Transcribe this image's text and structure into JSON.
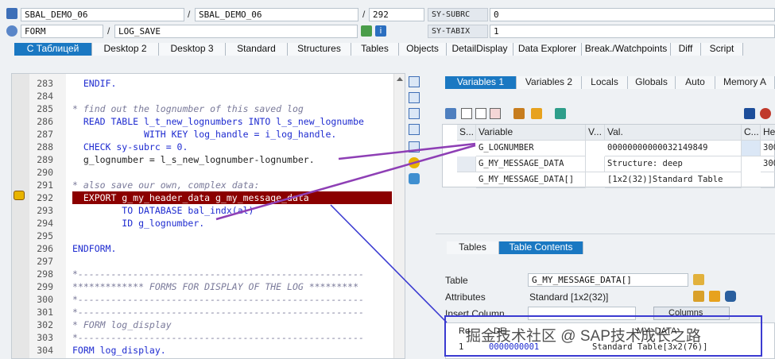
{
  "header": {
    "program1": "SBAL_DEMO_06",
    "program2": "SBAL_DEMO_06",
    "line": "292",
    "subrc_label": "SY-SUBRC",
    "subrc_value": "0",
    "event_type": "FORM",
    "event_name": "LOG_SAVE",
    "tabix_label": "SY-TABIX",
    "tabix_value": "1",
    "sep": "/"
  },
  "desktop_tabs": [
    "С Таблицей",
    "Desktop 2",
    "Desktop 3",
    "Standard",
    "Structures",
    "Tables",
    "Objects",
    "DetailDisplay",
    "Data Explorer",
    "Break./Watchpoints",
    "Diff",
    "Script"
  ],
  "code": {
    "lines": [
      {
        "n": "283",
        "t": "  ENDIF."
      },
      {
        "n": "284",
        "t": ""
      },
      {
        "n": "285",
        "t": "* find out the lognumber of this saved log"
      },
      {
        "n": "286",
        "t": "  READ TABLE l_t_new_lognumbers INTO l_s_new_lognumbe"
      },
      {
        "n": "287",
        "t": "             WITH KEY log_handle = i_log_handle."
      },
      {
        "n": "288",
        "t": "  CHECK sy-subrc = 0."
      },
      {
        "n": "289",
        "t": "  g_lognumber = l_s_new_lognumber-lognumber."
      },
      {
        "n": "290",
        "t": ""
      },
      {
        "n": "291",
        "t": "* also save our own, complex data:"
      },
      {
        "n": "292",
        "t": "  EXPORT g_my_header_data g_my_message_data"
      },
      {
        "n": "293",
        "t": "         TO DATABASE bal_indx(al)"
      },
      {
        "n": "294",
        "t": "         ID g_lognumber."
      },
      {
        "n": "295",
        "t": ""
      },
      {
        "n": "296",
        "t": "ENDFORM."
      },
      {
        "n": "297",
        "t": ""
      },
      {
        "n": "298",
        "t": "*----------------------------------------------------"
      },
      {
        "n": "299",
        "t": "************* FORMS FOR DISPLAY OF THE LOG *********"
      },
      {
        "n": "300",
        "t": "*----------------------------------------------------"
      },
      {
        "n": "301",
        "t": "*----------------------------------------------------"
      },
      {
        "n": "302",
        "t": "* FORM log_display"
      },
      {
        "n": "303",
        "t": "*----------------------------------------------------"
      },
      {
        "n": "304",
        "t": "FORM log_display."
      }
    ]
  },
  "var_tabs": [
    "Variables 1",
    "Variables 2",
    "Locals",
    "Globals",
    "Auto",
    "Memory A"
  ],
  "var_grid": {
    "headers": [
      "S...",
      "Variable",
      "V...",
      "Val.",
      "C...",
      "He"
    ],
    "rows": [
      {
        "variable": "G_LOGNUMBER",
        "value": "00000000000032149849",
        "hex": "300"
      },
      {
        "variable": "G_MY_MESSAGE_DATA",
        "value": "Structure: deep",
        "hex": "300"
      },
      {
        "variable": "G_MY_MESSAGE_DATA[]",
        "value": "[1x2(32)]Standard Table",
        "hex": ""
      }
    ]
  },
  "table_tabs": [
    "Tables",
    "Table Contents"
  ],
  "table_panel": {
    "table_label": "Table",
    "table_value": "G_MY_MESSAGE_DATA[]",
    "attributes_label": "Attributes",
    "attributes_value": "Standard [1x2(32)]",
    "insert_column_label": "Insert Column",
    "columns_button": "Columns",
    "row_num": "1",
    "row_key": "0000000001",
    "row_value": "Standard Table[3x2(76)]",
    "col_header_left": "Ro",
    "col_header_mid": "DE",
    "col_header_right": "MY_DATA"
  },
  "watermark": "掘金技术社区 @ SAP技术成长之路",
  "colors": {
    "accent": "#1a78c2",
    "highlight_line": "#8b0000",
    "annotation": "#8e3fb5",
    "box": "#3b3bd1"
  }
}
